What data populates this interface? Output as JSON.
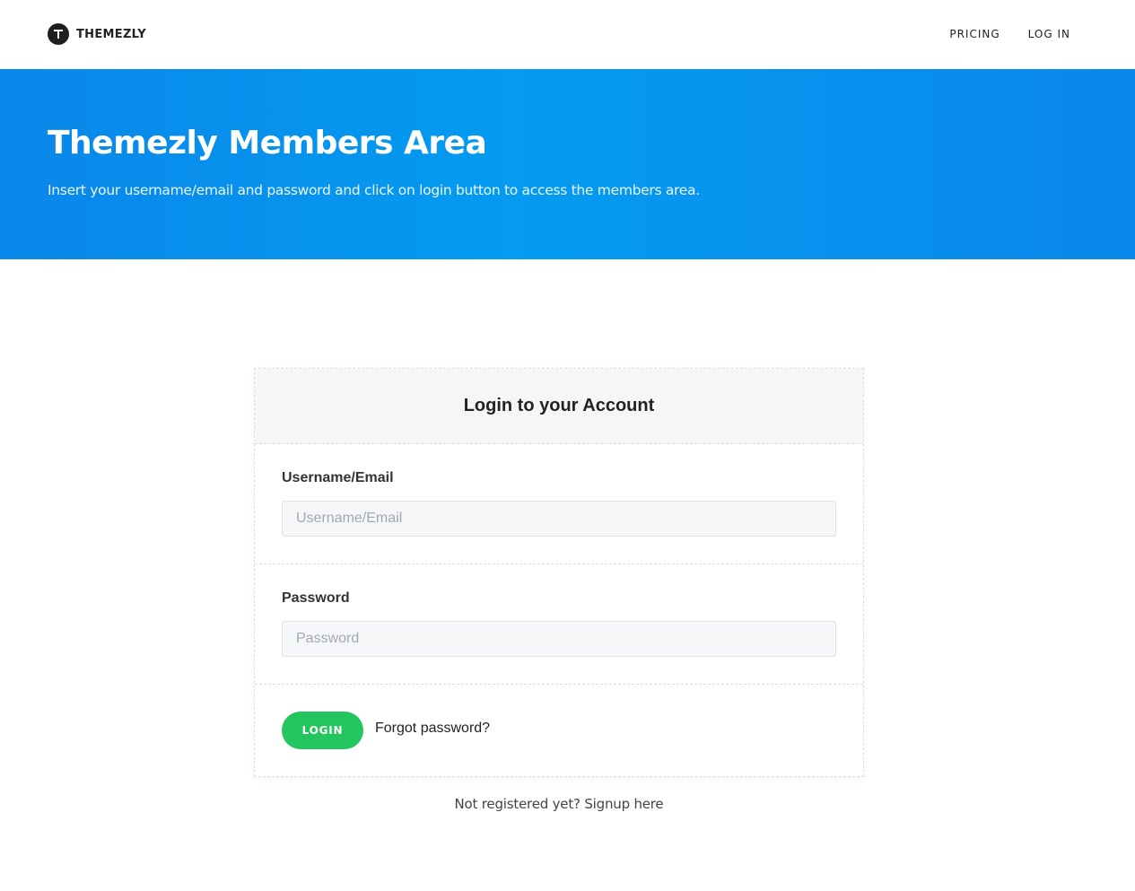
{
  "header": {
    "brand": "THEMEZLY",
    "nav": {
      "pricing": "PRICING",
      "login": "LOG IN"
    }
  },
  "hero": {
    "title": "Themezly Members Area",
    "subtitle": "Insert your username/email and password and click on login button to access the members area.",
    "background_color": "#049bf0"
  },
  "login_card": {
    "title": "Login to your Account",
    "username": {
      "label": "Username/Email",
      "placeholder": "Username/Email",
      "value": ""
    },
    "password": {
      "label": "Password",
      "placeholder": "Password",
      "value": ""
    },
    "login_button": "LOGIN",
    "login_button_color": "#22c55e",
    "forgot_link": "Forgot password?"
  },
  "signup": {
    "prompt": "Not registered yet?",
    "link": "Signup here"
  }
}
